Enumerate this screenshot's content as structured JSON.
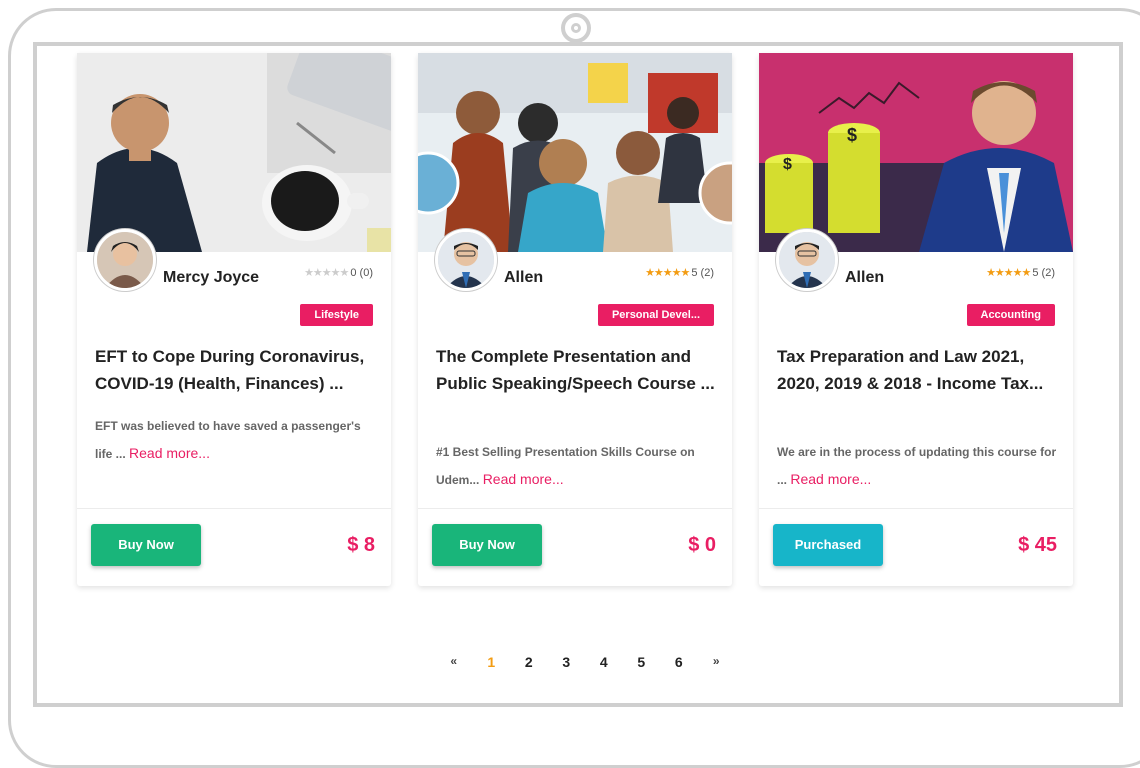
{
  "cards": [
    {
      "instructor": "Mercy Joyce",
      "rating_count": "0 (0)",
      "stars_filled": 0,
      "category": "Lifestyle",
      "title": "EFT to Cope During Coronavirus, COVID-19 (Health, Finances) ...",
      "desc": "EFT was believed to have saved a passenger's life ...",
      "read_more": "Read more...",
      "button": "Buy Now",
      "price": "$ 8"
    },
    {
      "instructor": "Allen",
      "rating_count": "5 (2)",
      "stars_filled": 5,
      "category": "Personal Devel...",
      "title": "The Complete Presentation and Public Speaking/Speech Course ...",
      "desc": "#1 Best Selling Presentation Skills Course on Udem...",
      "read_more": "Read more...",
      "button": "Buy Now",
      "price": "$ 0"
    },
    {
      "instructor": "Allen",
      "rating_count": "5 (2)",
      "stars_filled": 5,
      "category": "Accounting",
      "title": "Tax Preparation and Law 2021, 2020, 2019 & 2018 - Income Tax...",
      "desc": "We are in the process of updating this course for ...",
      "read_more": "Read more...",
      "button": "Purchased",
      "price": "$ 45"
    }
  ],
  "pagination": {
    "prev": "«",
    "pages": [
      "1",
      "2",
      "3",
      "4",
      "5",
      "6"
    ],
    "active": "1",
    "next": "»"
  },
  "colors": {
    "accent": "#e91e63",
    "buy": "#19b57a",
    "purchased": "#17b5c9",
    "star": "#f39c12",
    "active_page": "#f39c12"
  }
}
